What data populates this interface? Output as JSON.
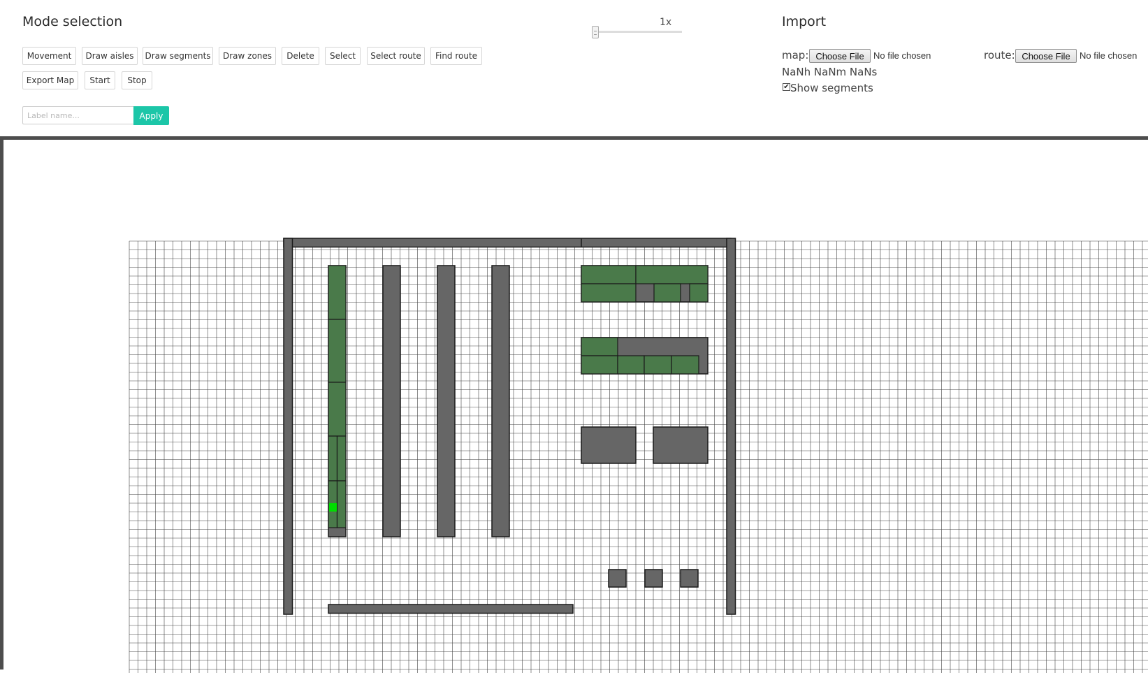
{
  "mode_panel": {
    "title": "Mode selection",
    "buttons": {
      "movement": "Movement",
      "draw_aisles": "Draw aisles",
      "draw_segments": "Draw segments",
      "draw_zones": "Draw zones",
      "delete": "Delete",
      "select": "Select",
      "select_route": "Select route",
      "find_route": "Find route",
      "export_map": "Export Map",
      "start": "Start",
      "stop": "Stop"
    },
    "label_input": {
      "placeholder": "Label name...",
      "value": ""
    },
    "apply_label": "Apply",
    "accent_color": "#1cc6a8"
  },
  "speed": {
    "label": "1x",
    "value_fraction": 0.0
  },
  "import_panel": {
    "title": "Import",
    "map_label": "map:",
    "map_button": "Choose File",
    "map_status": "No file chosen",
    "route_label": "route:",
    "route_button": "Choose File",
    "route_status": "No file chosen",
    "timer": "NaNh NaNm NaNs",
    "show_segments_label": "Show segments",
    "show_segments_checked": true
  },
  "map": {
    "colors": {
      "grid_line": "#444444",
      "wall": "#666666",
      "rack": "#666666",
      "segment": "#4a7a4a",
      "robot": "#00dd00",
      "outline": "#1a1a1a"
    },
    "grid_cell_size": 12.5
  }
}
